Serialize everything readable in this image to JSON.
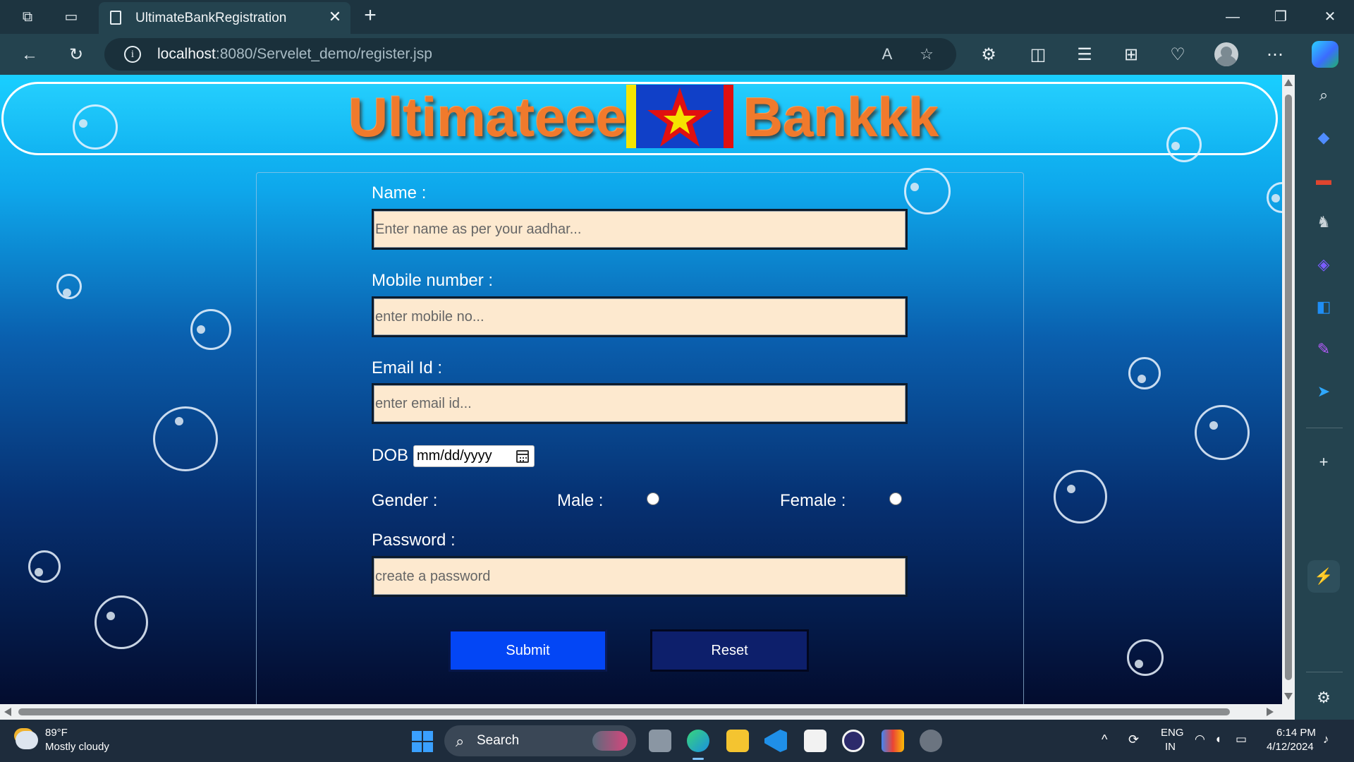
{
  "browser": {
    "tab_title": "UltimateBankRegistration",
    "url_host": "localhost",
    "url_path": ":8080/Servelet_demo/register.jsp"
  },
  "page": {
    "brand_left": "Ultimateee",
    "brand_right": "Bankkk",
    "form": {
      "name_label": "Name :",
      "name_placeholder": "Enter name as per your aadhar...",
      "mobile_label": "Mobile number :",
      "mobile_placeholder": "enter mobile no...",
      "email_label": "Email Id :",
      "email_placeholder": "enter email id...",
      "dob_label": "DOB",
      "dob_placeholder": "mm/dd/yyyy",
      "gender_label": "Gender :",
      "male_label": "Male :",
      "female_label": "Female :",
      "password_label": "Password :",
      "password_placeholder": "create a password",
      "submit_label": "Submit",
      "reset_label": "Reset"
    }
  },
  "taskbar": {
    "weather_temp": "89°F",
    "weather_desc": "Mostly cloudy",
    "search_label": "Search",
    "lang_top": "ENG",
    "lang_bottom": "IN",
    "time": "6:14 PM",
    "date": "4/12/2024"
  },
  "colors": {
    "brand_orange": "#f07a2c",
    "field_bg": "#fde9cf",
    "submit_bg": "#0346f5",
    "reset_bg": "#0d1f6b"
  }
}
